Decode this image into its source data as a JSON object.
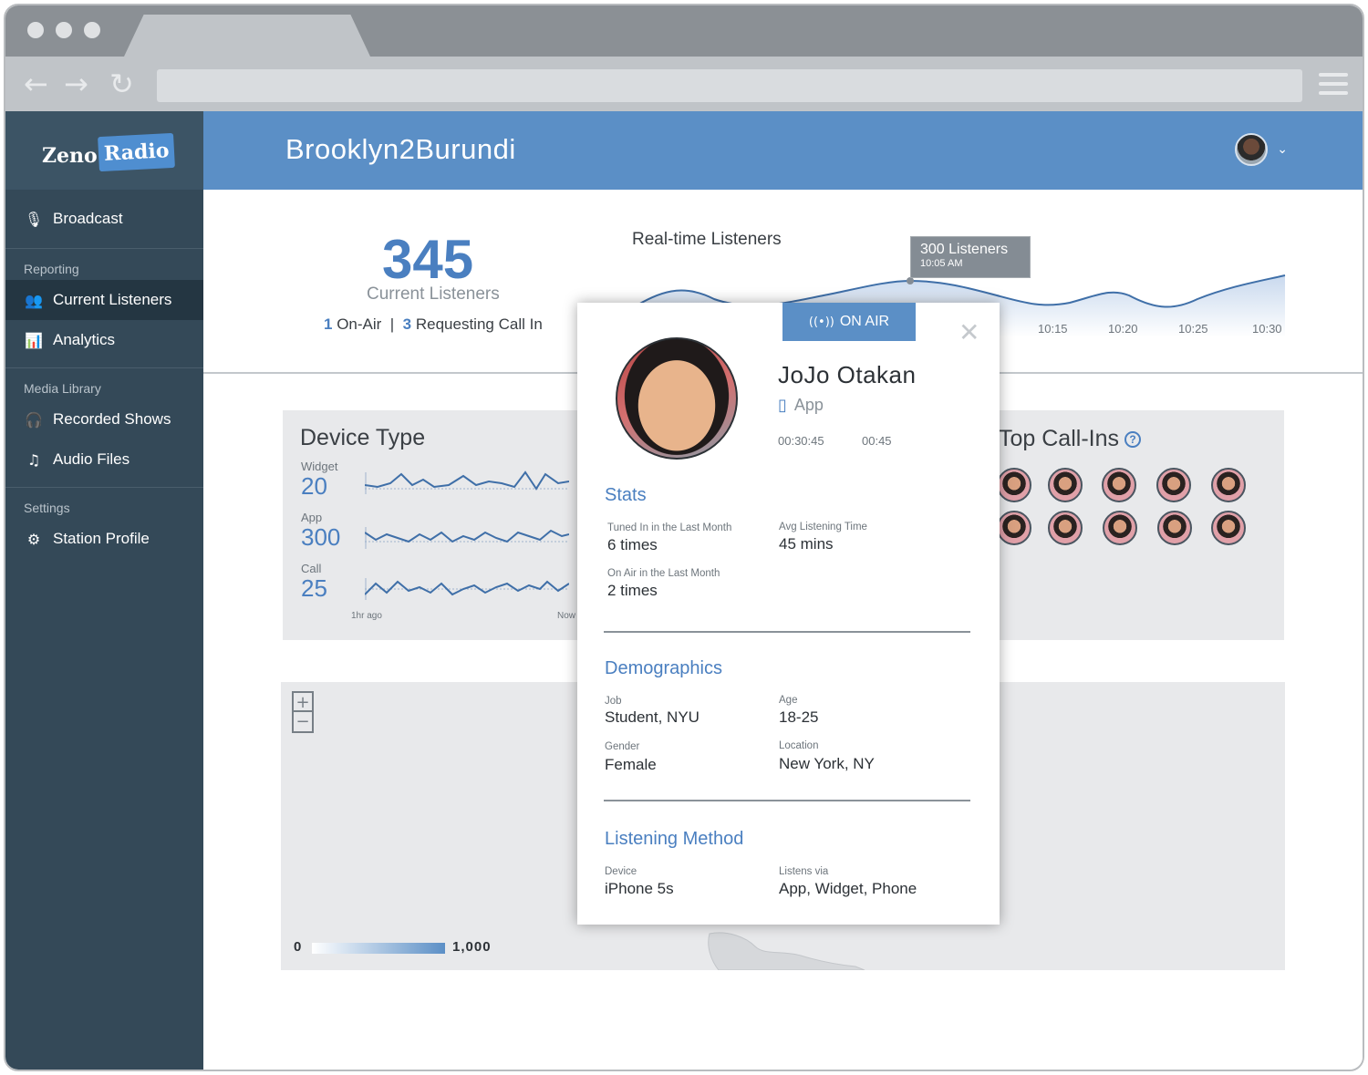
{
  "app": {
    "logo_word1": "Zeno",
    "logo_word2": "Radio",
    "station_name": "Brooklyn2Burundi"
  },
  "sidebar": {
    "broadcast": "Broadcast",
    "sections": {
      "reporting": "Reporting",
      "media": "Media Library",
      "settings": "Settings"
    },
    "items": {
      "current_listeners": "Current Listeners",
      "analytics": "Analytics",
      "recorded_shows": "Recorded Shows",
      "audio_files": "Audio Files",
      "station_profile": "Station Profile"
    }
  },
  "summary": {
    "count": "345",
    "label": "Current Listeners",
    "on_air_count": "1",
    "on_air_label": "On-Air",
    "separator": "|",
    "requesting_count": "3",
    "requesting_label": "Requesting Call In"
  },
  "realtime": {
    "title": "Real-time Listeners",
    "tooltip_value": "300 Listeners",
    "tooltip_time": "10:05 AM",
    "ticks": [
      "10:15",
      "10:20",
      "10:25",
      "10:30"
    ]
  },
  "device_type": {
    "title": "Device Type",
    "rows": [
      {
        "label": "Widget",
        "value": "20"
      },
      {
        "label": "App",
        "value": "300"
      },
      {
        "label": "Call",
        "value": "25"
      }
    ],
    "axis_start": "1hr ago",
    "axis_end": "Now"
  },
  "top_callins": {
    "title": "Top Call-Ins",
    "help": "?"
  },
  "map": {
    "zoom_in": "+",
    "zoom_out": "−",
    "legend_min": "0",
    "legend_max": "1,000"
  },
  "modal": {
    "status": "ON AIR",
    "close": "✕",
    "name": "JoJo Otakan",
    "device": "App",
    "time1": "00:30:45",
    "time2": "00:45",
    "stats": {
      "title": "Stats",
      "tuned_label": "Tuned In in the Last Month",
      "tuned_value": "6 times",
      "avg_label": "Avg Listening Time",
      "avg_value": "45 mins",
      "onair_label": "On Air in the Last Month",
      "onair_value": "2 times"
    },
    "demographics": {
      "title": "Demographics",
      "job_label": "Job",
      "job_value": "Student, NYU",
      "age_label": "Age",
      "age_value": "18-25",
      "gender_label": "Gender",
      "gender_value": "Female",
      "location_label": "Location",
      "location_value": "New York, NY"
    },
    "listening": {
      "title": "Listening Method",
      "device_label": "Device",
      "device_value": "iPhone 5s",
      "via_label": "Listens via",
      "via_value": "App, Widget, Phone"
    }
  },
  "colors": {
    "accent": "#5b8fc6",
    "sidebar": "#344958",
    "value_blue": "#4a7fc0"
  }
}
